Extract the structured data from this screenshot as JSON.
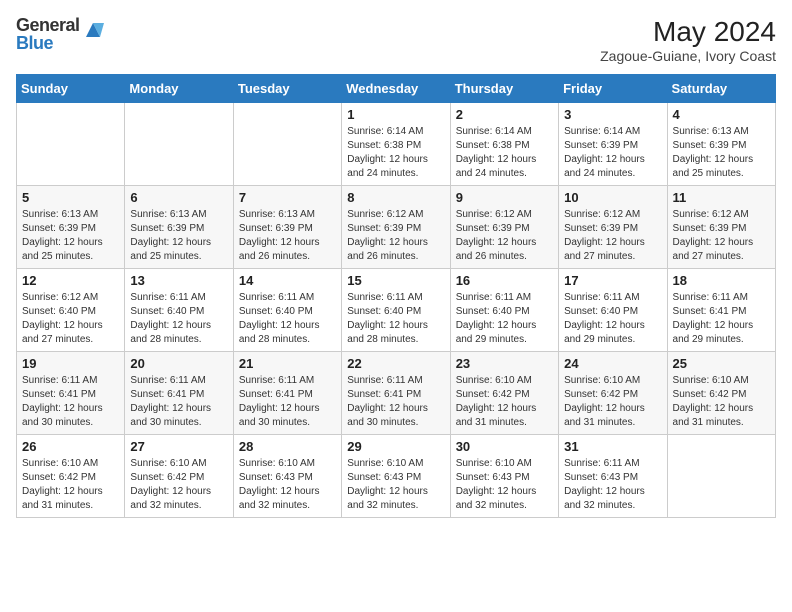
{
  "header": {
    "logo_general": "General",
    "logo_blue": "Blue",
    "month_year": "May 2024",
    "location": "Zagoue-Guiane, Ivory Coast"
  },
  "days_of_week": [
    "Sunday",
    "Monday",
    "Tuesday",
    "Wednesday",
    "Thursday",
    "Friday",
    "Saturday"
  ],
  "weeks": [
    [
      {
        "day": "",
        "info": ""
      },
      {
        "day": "",
        "info": ""
      },
      {
        "day": "",
        "info": ""
      },
      {
        "day": "1",
        "info": "Sunrise: 6:14 AM\nSunset: 6:38 PM\nDaylight: 12 hours and 24 minutes."
      },
      {
        "day": "2",
        "info": "Sunrise: 6:14 AM\nSunset: 6:38 PM\nDaylight: 12 hours and 24 minutes."
      },
      {
        "day": "3",
        "info": "Sunrise: 6:14 AM\nSunset: 6:39 PM\nDaylight: 12 hours and 24 minutes."
      },
      {
        "day": "4",
        "info": "Sunrise: 6:13 AM\nSunset: 6:39 PM\nDaylight: 12 hours and 25 minutes."
      }
    ],
    [
      {
        "day": "5",
        "info": "Sunrise: 6:13 AM\nSunset: 6:39 PM\nDaylight: 12 hours and 25 minutes."
      },
      {
        "day": "6",
        "info": "Sunrise: 6:13 AM\nSunset: 6:39 PM\nDaylight: 12 hours and 25 minutes."
      },
      {
        "day": "7",
        "info": "Sunrise: 6:13 AM\nSunset: 6:39 PM\nDaylight: 12 hours and 26 minutes."
      },
      {
        "day": "8",
        "info": "Sunrise: 6:12 AM\nSunset: 6:39 PM\nDaylight: 12 hours and 26 minutes."
      },
      {
        "day": "9",
        "info": "Sunrise: 6:12 AM\nSunset: 6:39 PM\nDaylight: 12 hours and 26 minutes."
      },
      {
        "day": "10",
        "info": "Sunrise: 6:12 AM\nSunset: 6:39 PM\nDaylight: 12 hours and 27 minutes."
      },
      {
        "day": "11",
        "info": "Sunrise: 6:12 AM\nSunset: 6:39 PM\nDaylight: 12 hours and 27 minutes."
      }
    ],
    [
      {
        "day": "12",
        "info": "Sunrise: 6:12 AM\nSunset: 6:40 PM\nDaylight: 12 hours and 27 minutes."
      },
      {
        "day": "13",
        "info": "Sunrise: 6:11 AM\nSunset: 6:40 PM\nDaylight: 12 hours and 28 minutes."
      },
      {
        "day": "14",
        "info": "Sunrise: 6:11 AM\nSunset: 6:40 PM\nDaylight: 12 hours and 28 minutes."
      },
      {
        "day": "15",
        "info": "Sunrise: 6:11 AM\nSunset: 6:40 PM\nDaylight: 12 hours and 28 minutes."
      },
      {
        "day": "16",
        "info": "Sunrise: 6:11 AM\nSunset: 6:40 PM\nDaylight: 12 hours and 29 minutes."
      },
      {
        "day": "17",
        "info": "Sunrise: 6:11 AM\nSunset: 6:40 PM\nDaylight: 12 hours and 29 minutes."
      },
      {
        "day": "18",
        "info": "Sunrise: 6:11 AM\nSunset: 6:41 PM\nDaylight: 12 hours and 29 minutes."
      }
    ],
    [
      {
        "day": "19",
        "info": "Sunrise: 6:11 AM\nSunset: 6:41 PM\nDaylight: 12 hours and 30 minutes."
      },
      {
        "day": "20",
        "info": "Sunrise: 6:11 AM\nSunset: 6:41 PM\nDaylight: 12 hours and 30 minutes."
      },
      {
        "day": "21",
        "info": "Sunrise: 6:11 AM\nSunset: 6:41 PM\nDaylight: 12 hours and 30 minutes."
      },
      {
        "day": "22",
        "info": "Sunrise: 6:11 AM\nSunset: 6:41 PM\nDaylight: 12 hours and 30 minutes."
      },
      {
        "day": "23",
        "info": "Sunrise: 6:10 AM\nSunset: 6:42 PM\nDaylight: 12 hours and 31 minutes."
      },
      {
        "day": "24",
        "info": "Sunrise: 6:10 AM\nSunset: 6:42 PM\nDaylight: 12 hours and 31 minutes."
      },
      {
        "day": "25",
        "info": "Sunrise: 6:10 AM\nSunset: 6:42 PM\nDaylight: 12 hours and 31 minutes."
      }
    ],
    [
      {
        "day": "26",
        "info": "Sunrise: 6:10 AM\nSunset: 6:42 PM\nDaylight: 12 hours and 31 minutes."
      },
      {
        "day": "27",
        "info": "Sunrise: 6:10 AM\nSunset: 6:42 PM\nDaylight: 12 hours and 32 minutes."
      },
      {
        "day": "28",
        "info": "Sunrise: 6:10 AM\nSunset: 6:43 PM\nDaylight: 12 hours and 32 minutes."
      },
      {
        "day": "29",
        "info": "Sunrise: 6:10 AM\nSunset: 6:43 PM\nDaylight: 12 hours and 32 minutes."
      },
      {
        "day": "30",
        "info": "Sunrise: 6:10 AM\nSunset: 6:43 PM\nDaylight: 12 hours and 32 minutes."
      },
      {
        "day": "31",
        "info": "Sunrise: 6:11 AM\nSunset: 6:43 PM\nDaylight: 12 hours and 32 minutes."
      },
      {
        "day": "",
        "info": ""
      }
    ]
  ]
}
